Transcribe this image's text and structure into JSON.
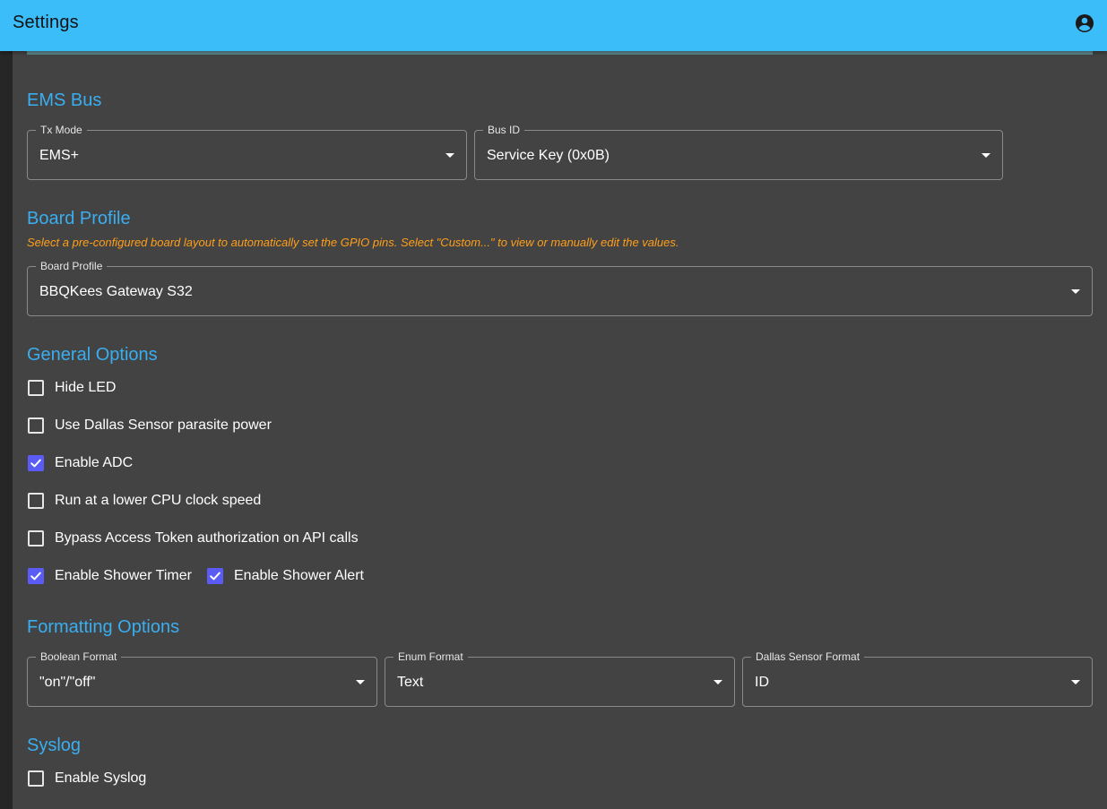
{
  "app": {
    "title": "Settings"
  },
  "colors": {
    "appbar": "#3bbdf9",
    "section_title": "#3aaef0",
    "helper": "#ff9f1a",
    "checkbox_checked": "#5a5cf5"
  },
  "icons": {
    "account": "account-circle-icon",
    "dropdown": "arrow-drop-down-icon",
    "check": "check-icon"
  },
  "ems_bus": {
    "title": "EMS Bus",
    "tx_mode": {
      "label": "Tx Mode",
      "value": "EMS+"
    },
    "bus_id": {
      "label": "Bus ID",
      "value": "Service Key (0x0B)"
    }
  },
  "board_profile": {
    "title": "Board Profile",
    "helper": "Select a pre-configured board layout to automatically set the GPIO pins. Select \"Custom...\" to view or manually edit the values.",
    "select": {
      "label": "Board Profile",
      "value": "BBQKees Gateway S32"
    }
  },
  "general_options": {
    "title": "General Options",
    "items": [
      {
        "label": "Hide LED",
        "checked": false
      },
      {
        "label": "Use Dallas Sensor parasite power",
        "checked": false
      },
      {
        "label": "Enable ADC",
        "checked": true
      },
      {
        "label": "Run at a lower CPU clock speed",
        "checked": false
      },
      {
        "label": "Bypass Access Token authorization on API calls",
        "checked": false
      },
      {
        "label": "Enable Shower Timer",
        "checked": true
      },
      {
        "label": "Enable Shower Alert",
        "checked": true
      }
    ]
  },
  "formatting_options": {
    "title": "Formatting Options",
    "boolean_format": {
      "label": "Boolean Format",
      "value": "\"on\"/\"off\""
    },
    "enum_format": {
      "label": "Enum Format",
      "value": "Text"
    },
    "dallas_format": {
      "label": "Dallas Sensor Format",
      "value": "ID"
    }
  },
  "syslog": {
    "title": "Syslog",
    "enable": {
      "label": "Enable Syslog",
      "checked": false
    }
  }
}
